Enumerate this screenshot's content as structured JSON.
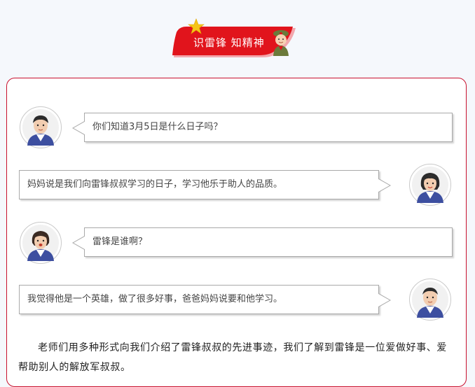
{
  "banner": {
    "title": "识雷锋 知精神"
  },
  "colors": {
    "accent": "#c8102e",
    "banner_red": "#e1141c",
    "background": "#f5f8fc"
  },
  "conversation": [
    {
      "side": "left",
      "text": "你们知道3月5日是什么日子吗？",
      "avatar": "boy-avatar"
    },
    {
      "side": "right",
      "text": "妈妈说是我们向雷锋叔叔学习的日子，学习他乐于助人的品质。",
      "avatar": "girl-avatar"
    },
    {
      "side": "left",
      "text": "雷锋是谁啊？",
      "avatar": "girl-avatar"
    },
    {
      "side": "right",
      "text": "我觉得他是一个英雄，做了很多好事，爸爸妈妈说要和他学习。",
      "avatar": "boy-avatar"
    }
  ],
  "paragraph": "老师们用多种形式向我们介绍了雷锋叔叔的先进事迹，我们了解到雷锋是一位爱做好事、爱帮助别人的解放军叔叔。"
}
